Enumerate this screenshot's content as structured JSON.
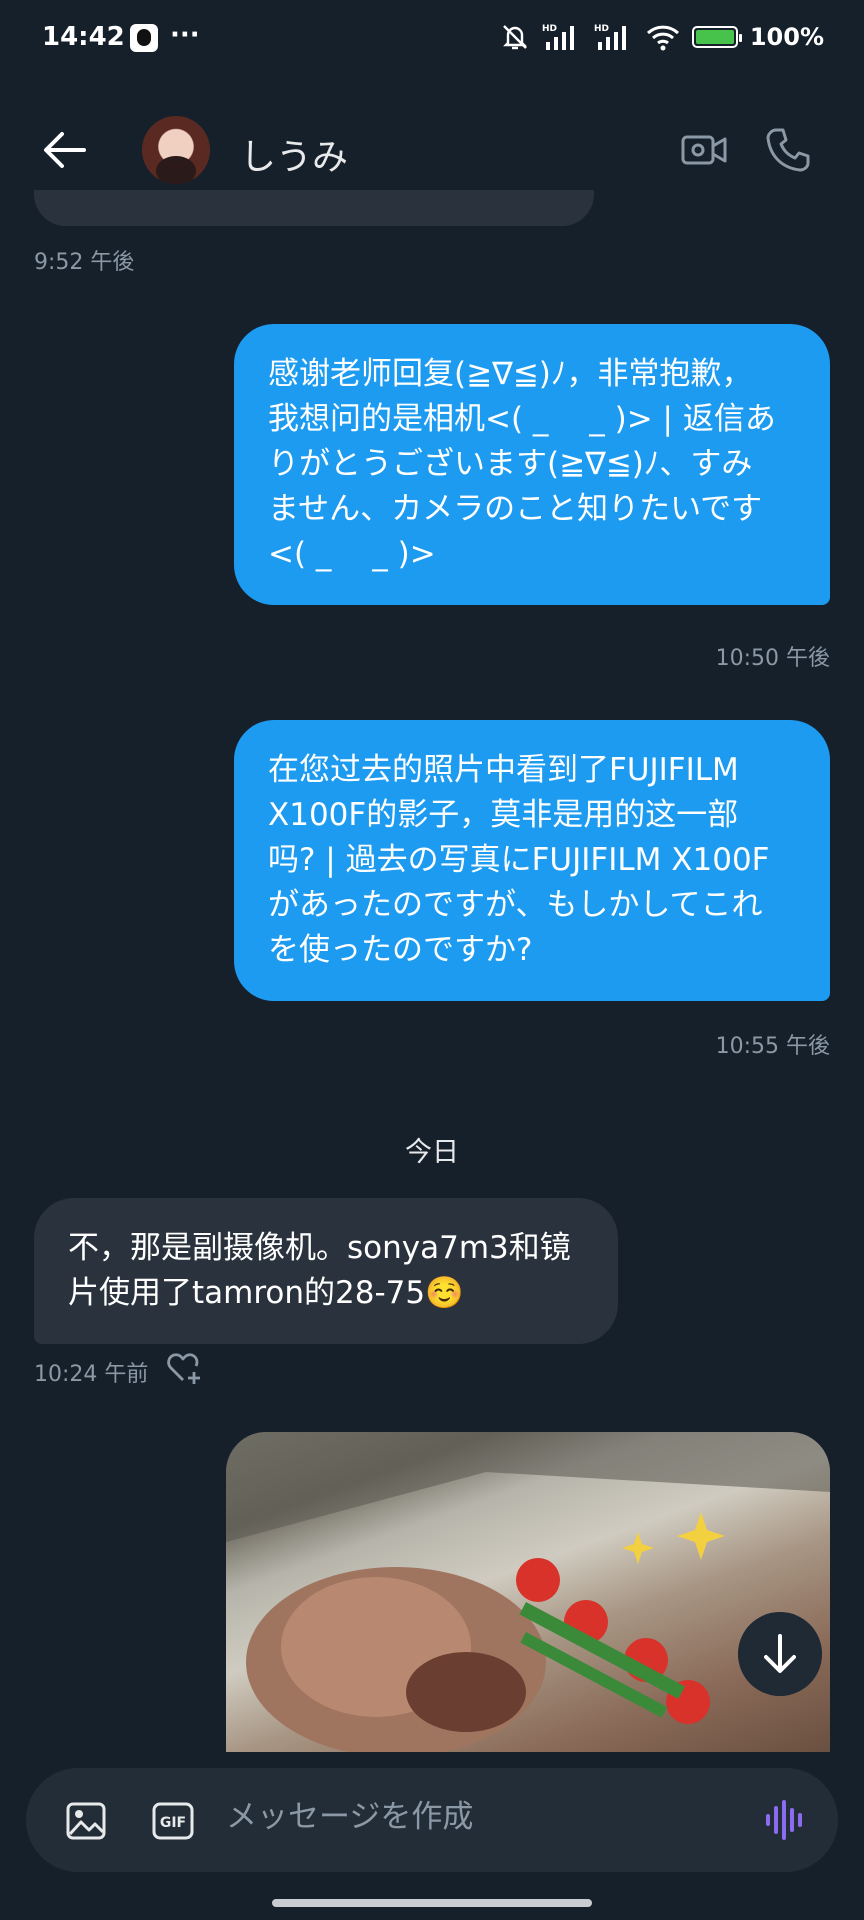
{
  "status": {
    "time": "14:42",
    "more": "···",
    "battery": "100%"
  },
  "header": {
    "contact_name": "しうみ"
  },
  "messages": [
    {
      "time": "9:52 午後"
    },
    {
      "text": "感谢老师回复(≧∇≦)ﾉ，非常抱歉，\n我想问的是相机<( _　 _ )> | 返信あ\nりがとうございます(≧∇≦)ﾉ、すみ\nません、カメラのこと知りたいです\n<( _　 _ )>",
      "time": "10:50 午後"
    },
    {
      "text": "在您过去的照片中看到了FUJIFILM\nX100F的影子，莫非是用的这一部\n吗? | 過去の写真にFUJIFILM X100F\nがあったのですが、もしかしてこれ\nを使ったのですか?",
      "time": "10:55 午後"
    },
    {
      "text": "不，那是副摄像机。sonya7m3和镜\n片使用了tamron的28-75☺️",
      "time": "10:24 午前"
    }
  ],
  "date_divider": "今日",
  "composer": {
    "placeholder": "メッセージを作成"
  },
  "colors": {
    "background": "#16202b",
    "outgoing_bubble": "#1d9bf0",
    "incoming_bubble": "#2a333d",
    "voice_accent": "#8a6cf0"
  }
}
